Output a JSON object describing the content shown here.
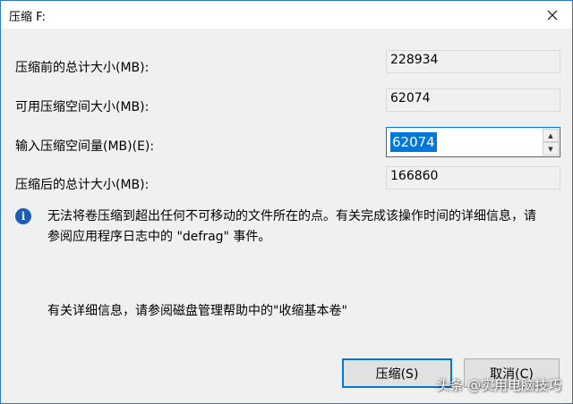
{
  "window": {
    "title": "压缩 F:",
    "close_icon": "close-icon"
  },
  "fields": {
    "total_before": {
      "label": "压缩前的总计大小(MB):",
      "value": "228934"
    },
    "available": {
      "label": "可用压缩空间大小(MB):",
      "value": "62074"
    },
    "input_amount": {
      "label": "输入压缩空间量(MB)(E):",
      "value": "62074"
    },
    "total_after": {
      "label": "压缩后的总计大小(MB):",
      "value": "166860"
    }
  },
  "info": {
    "icon": "info-icon",
    "line1": "无法将卷压缩到超出任何不可移动的文件所在的点。有关完成该操作时间的详细信息，请",
    "line2": "参阅应用程序日志中的 \"defrag\" 事件。"
  },
  "help": {
    "text": "有关详细信息，请参阅磁盘管理帮助中的\"收缩基本卷\""
  },
  "buttons": {
    "shrink_label": "压缩(S)",
    "cancel_label": "取消(C)"
  },
  "watermark": {
    "text": "头条 @实用电脑技巧"
  },
  "colors": {
    "accent": "#0078d7",
    "info_icon": "#1a5fb4",
    "window_border": "#2b79c9"
  }
}
